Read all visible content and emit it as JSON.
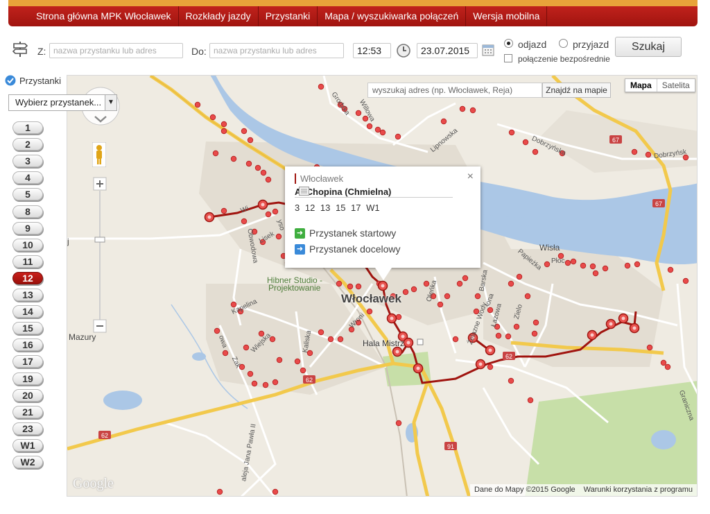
{
  "nav": {
    "items": [
      {
        "label": "Strona główna MPK Włocławek"
      },
      {
        "label": "Rozkłady jazdy"
      },
      {
        "label": "Przystanki"
      },
      {
        "label": "Mapa / wyszukiwarka połączeń"
      },
      {
        "label": "Wersja mobilna"
      }
    ]
  },
  "search": {
    "from_label": "Z:",
    "from_placeholder": "nazwa przystanku lub adres",
    "to_label": "Do:",
    "to_placeholder": "nazwa przystanku lub adres",
    "time": "12:53",
    "date": "23.07.2015",
    "departure_label": "odjazd",
    "arrival_label": "przyjazd",
    "direct_label": "połączenie bezpośrednie",
    "search_button": "Szukaj"
  },
  "sidebar": {
    "stops_label": "Przystanki",
    "stop_select": "Wybierz przystanek...",
    "lines": [
      "1",
      "2",
      "3",
      "4",
      "5",
      "8",
      "9",
      "10",
      "11",
      "12",
      "13",
      "14",
      "15",
      "16",
      "17",
      "19",
      "20",
      "21",
      "23",
      "W1",
      "W2"
    ],
    "active_line": "12"
  },
  "map": {
    "address_placeholder": "wyszukaj adres (np. Włocławek, Reja)",
    "find_button": "Znajdź na mapie",
    "type_map": "Mapa",
    "type_satellite": "Satelita",
    "city_label": "Włocławek",
    "attribution_data": "Dane do Mapy ©2015 Google",
    "attribution_terms": "Warunki korzystania z programu",
    "logo": "Google",
    "place_labels": {
      "mazury": "Mazury",
      "hibner": "Hibner Studio -",
      "hibner2": "Projektowanie",
      "hala": "Hala Mistrz",
      "wisla": "Wisła",
      "j": "j"
    },
    "street_labels": {
      "grodzka": "Grodzka",
      "willowa": "Willowa",
      "lipnowska": "Lipnowska",
      "dobrzynska": "Dobrzyńska",
      "dobrzynsk2": "Dobrzyńsk",
      "obwodowa": "Obwodowa",
      "lisek": "Lisek",
      "kapelina": "Kapelina",
      "wiejska": "Wiejska",
      "kaliska": "Kaliska",
      "wronia": "Wroni",
      "olenka": "Oleńka",
      "barska": "Barska",
      "papiezka": "Papieżka",
      "ploka": "Płoc",
      "zelazne": "Żelazne Wody",
      "zielona": "Zielo",
      "lazowa": "Łazowa",
      "jana": "aleja Jana Pawła II",
      "graniczna": "Graniczna",
      "wi": "Wi",
      "owa": "owa",
      "zyso": "yso",
      "zak": "Zak",
      "lona": "lona"
    },
    "road_shields": [
      "67",
      "67",
      "62",
      "62",
      "62",
      "91"
    ]
  },
  "popup": {
    "city": "Włocławek",
    "stop_name": "Al.Chopina (Chmielna)",
    "lines": "3 12 13 15 17 W1",
    "start_label": "Przystanek startowy",
    "end_label": "Przystanek docelowy",
    "close": "×"
  },
  "colors": {
    "brand": "#a0140f",
    "route": "#a0140f",
    "stop_marker": "#e84a4a",
    "water": "#abc7e6",
    "road_major": "#f2c94c",
    "park": "#c7dfa8"
  }
}
